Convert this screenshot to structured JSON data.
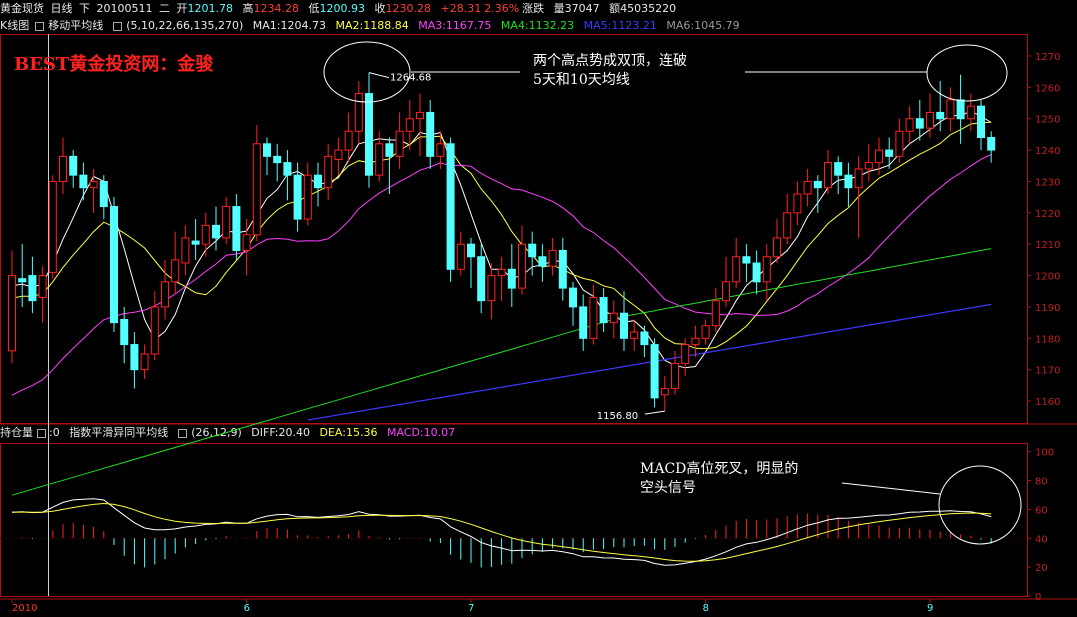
{
  "header": {
    "product": "黄金现货",
    "period": "日线",
    "dir": "下",
    "date": "20100511",
    "weekday": "二",
    "open_label": "开",
    "open": "1201.78",
    "high_label": "高",
    "high": "1234.28",
    "low_label": "低",
    "low": "1200.93",
    "close_label": "收",
    "close": "1230.28",
    "change_label": "涨跌",
    "change": "+28.31",
    "change_pct": "2.36%",
    "volume_label": "量",
    "volume": "37047",
    "amount_label": "额",
    "amount": "45035220"
  },
  "ma_bar": {
    "chart_name": "K线图",
    "indicator": "移动平均线",
    "params": "(5,10,22,66,135,270)",
    "ma1": "MA1:1204.73",
    "ma2": "MA2:1188.84",
    "ma3": "MA3:1167.75",
    "ma4": "MA4:1132.23",
    "ma5": "MA5:1123.21",
    "ma6": "MA6:1045.79"
  },
  "sub_bar": {
    "panel": "持仓量",
    "zero": ":0",
    "indicator": "指数平滑异同平均线",
    "params": "(26,12,9)",
    "diff": "DIFF:20.40",
    "dea": "DEA:15.36",
    "macd": "MACD:10.07"
  },
  "watermark": "BEST黄金投资网：金骏",
  "annotations": {
    "top_line1": "两个高点势成双顶，连破",
    "top_line2": "5天和10天均线",
    "macd_line1": "MACD高位死叉，明显的",
    "macd_line2": "空头信号",
    "peak_label": "1264.68",
    "trough_label": "1156.80"
  },
  "colors": {
    "up": "#ff2020",
    "down": "#54ffff",
    "ma5": "#ffffff",
    "ma10": "#ffff40",
    "ma22": "#ff40ff",
    "ma66": "#22dd22",
    "ma135": "#3a3aff",
    "axis": "#b01010"
  },
  "chart_data": [
    {
      "type": "candlestick",
      "price_axis": {
        "ticks": [
          1160,
          1170,
          1180,
          1190,
          1200,
          1210,
          1220,
          1230,
          1240,
          1250,
          1260,
          1270
        ]
      },
      "x_ticks": [
        {
          "label": "2010",
          "index": 0
        },
        {
          "label": "6",
          "index": 23
        },
        {
          "label": "7",
          "index": 45
        },
        {
          "label": "8",
          "index": 68
        },
        {
          "label": "9",
          "index": 90
        }
      ],
      "candles": [
        [
          1176,
          1200,
          1172,
          1208
        ],
        [
          1199,
          1198,
          1190,
          1210
        ],
        [
          1200,
          1192,
          1188,
          1206
        ],
        [
          1193,
          1200,
          1185,
          1203
        ],
        [
          1201,
          1230,
          1199,
          1232
        ],
        [
          1230,
          1238,
          1226,
          1244
        ],
        [
          1238,
          1232,
          1228,
          1240
        ],
        [
          1232,
          1228,
          1224,
          1236
        ],
        [
          1228,
          1230,
          1220,
          1234
        ],
        [
          1230,
          1222,
          1218,
          1232
        ],
        [
          1222,
          1185,
          1182,
          1225
        ],
        [
          1186,
          1178,
          1172,
          1190
        ],
        [
          1178,
          1170,
          1164,
          1182
        ],
        [
          1170,
          1175,
          1167,
          1178
        ],
        [
          1175,
          1190,
          1173,
          1195
        ],
        [
          1190,
          1198,
          1186,
          1205
        ],
        [
          1198,
          1205,
          1194,
          1214
        ],
        [
          1204,
          1212,
          1200,
          1216
        ],
        [
          1211,
          1210,
          1205,
          1218
        ],
        [
          1210,
          1216,
          1206,
          1220
        ],
        [
          1216,
          1212,
          1208,
          1222
        ],
        [
          1212,
          1222,
          1210,
          1225
        ],
        [
          1222,
          1208,
          1205,
          1226
        ],
        [
          1208,
          1213,
          1200,
          1218
        ],
        [
          1213,
          1242,
          1211,
          1248
        ],
        [
          1242,
          1238,
          1232,
          1244
        ],
        [
          1238,
          1236,
          1230,
          1242
        ],
        [
          1236,
          1232,
          1224,
          1240
        ],
        [
          1232,
          1218,
          1214,
          1236
        ],
        [
          1218,
          1232,
          1216,
          1236
        ],
        [
          1232,
          1228,
          1222,
          1236
        ],
        [
          1228,
          1238,
          1224,
          1242
        ],
        [
          1237,
          1240,
          1232,
          1244
        ],
        [
          1240,
          1246,
          1236,
          1252
        ],
        [
          1246,
          1258,
          1242,
          1262
        ],
        [
          1258,
          1232,
          1228,
          1264.68
        ],
        [
          1232,
          1242,
          1230,
          1246
        ],
        [
          1242,
          1238,
          1226,
          1244
        ],
        [
          1238,
          1246,
          1234,
          1252
        ],
        [
          1246,
          1250,
          1240,
          1256
        ],
        [
          1250,
          1252,
          1238,
          1258
        ],
        [
          1252,
          1238,
          1234,
          1256
        ],
        [
          1238,
          1242,
          1234,
          1246
        ],
        [
          1242,
          1202,
          1198,
          1244
        ],
        [
          1202,
          1210,
          1200,
          1214
        ],
        [
          1210,
          1206,
          1196,
          1212
        ],
        [
          1206,
          1192,
          1188,
          1210
        ],
        [
          1192,
          1200,
          1186,
          1204
        ],
        [
          1200,
          1202,
          1192,
          1206
        ],
        [
          1202,
          1196,
          1190,
          1210
        ],
        [
          1196,
          1210,
          1194,
          1216
        ],
        [
          1210,
          1206,
          1200,
          1214
        ],
        [
          1206,
          1203,
          1198,
          1210
        ],
        [
          1203,
          1208,
          1200,
          1212
        ],
        [
          1208,
          1196,
          1192,
          1212
        ],
        [
          1196,
          1190,
          1184,
          1198
        ],
        [
          1190,
          1180,
          1176,
          1194
        ],
        [
          1180,
          1193,
          1178,
          1197
        ],
        [
          1193,
          1185,
          1182,
          1196
        ],
        [
          1185,
          1188,
          1180,
          1192
        ],
        [
          1188,
          1180,
          1176,
          1195
        ],
        [
          1180,
          1182,
          1176,
          1186
        ],
        [
          1182,
          1178,
          1174,
          1184
        ],
        [
          1178,
          1161,
          1158,
          1180
        ],
        [
          1162,
          1164,
          1156.8,
          1168
        ],
        [
          1164,
          1172,
          1162,
          1176
        ],
        [
          1172,
          1178,
          1168,
          1180
        ],
        [
          1178,
          1180,
          1174,
          1184
        ],
        [
          1180,
          1184,
          1178,
          1186
        ],
        [
          1184,
          1192,
          1182,
          1196
        ],
        [
          1192,
          1198,
          1190,
          1206
        ],
        [
          1198,
          1206,
          1196,
          1212
        ],
        [
          1206,
          1204,
          1198,
          1210
        ],
        [
          1204,
          1198,
          1194,
          1208
        ],
        [
          1198,
          1206,
          1192,
          1210
        ],
        [
          1206,
          1212,
          1204,
          1218
        ],
        [
          1212,
          1220,
          1210,
          1226
        ],
        [
          1220,
          1226,
          1216,
          1230
        ],
        [
          1226,
          1230,
          1222,
          1234
        ],
        [
          1230,
          1228,
          1220,
          1232
        ],
        [
          1228,
          1236,
          1226,
          1240
        ],
        [
          1236,
          1232,
          1226,
          1238
        ],
        [
          1232,
          1228,
          1222,
          1236
        ],
        [
          1228,
          1234,
          1212,
          1238
        ],
        [
          1234,
          1236,
          1230,
          1242
        ],
        [
          1236,
          1240,
          1232,
          1244
        ],
        [
          1240,
          1238,
          1234,
          1244
        ],
        [
          1238,
          1246,
          1236,
          1250
        ],
        [
          1246,
          1250,
          1242,
          1254
        ],
        [
          1250,
          1247,
          1243,
          1256
        ],
        [
          1247,
          1252,
          1244,
          1258
        ],
        [
          1252,
          1250,
          1246,
          1262
        ],
        [
          1250,
          1256,
          1246,
          1260
        ],
        [
          1256,
          1250,
          1242,
          1264
        ],
        [
          1250,
          1254,
          1246,
          1258
        ],
        [
          1254,
          1244,
          1240,
          1256
        ],
        [
          1244,
          1240,
          1236,
          1246
        ]
      ]
    },
    {
      "type": "macd",
      "axis_ticks": [
        0,
        20,
        40,
        60,
        80,
        100
      ],
      "zero_level": 40
    }
  ]
}
